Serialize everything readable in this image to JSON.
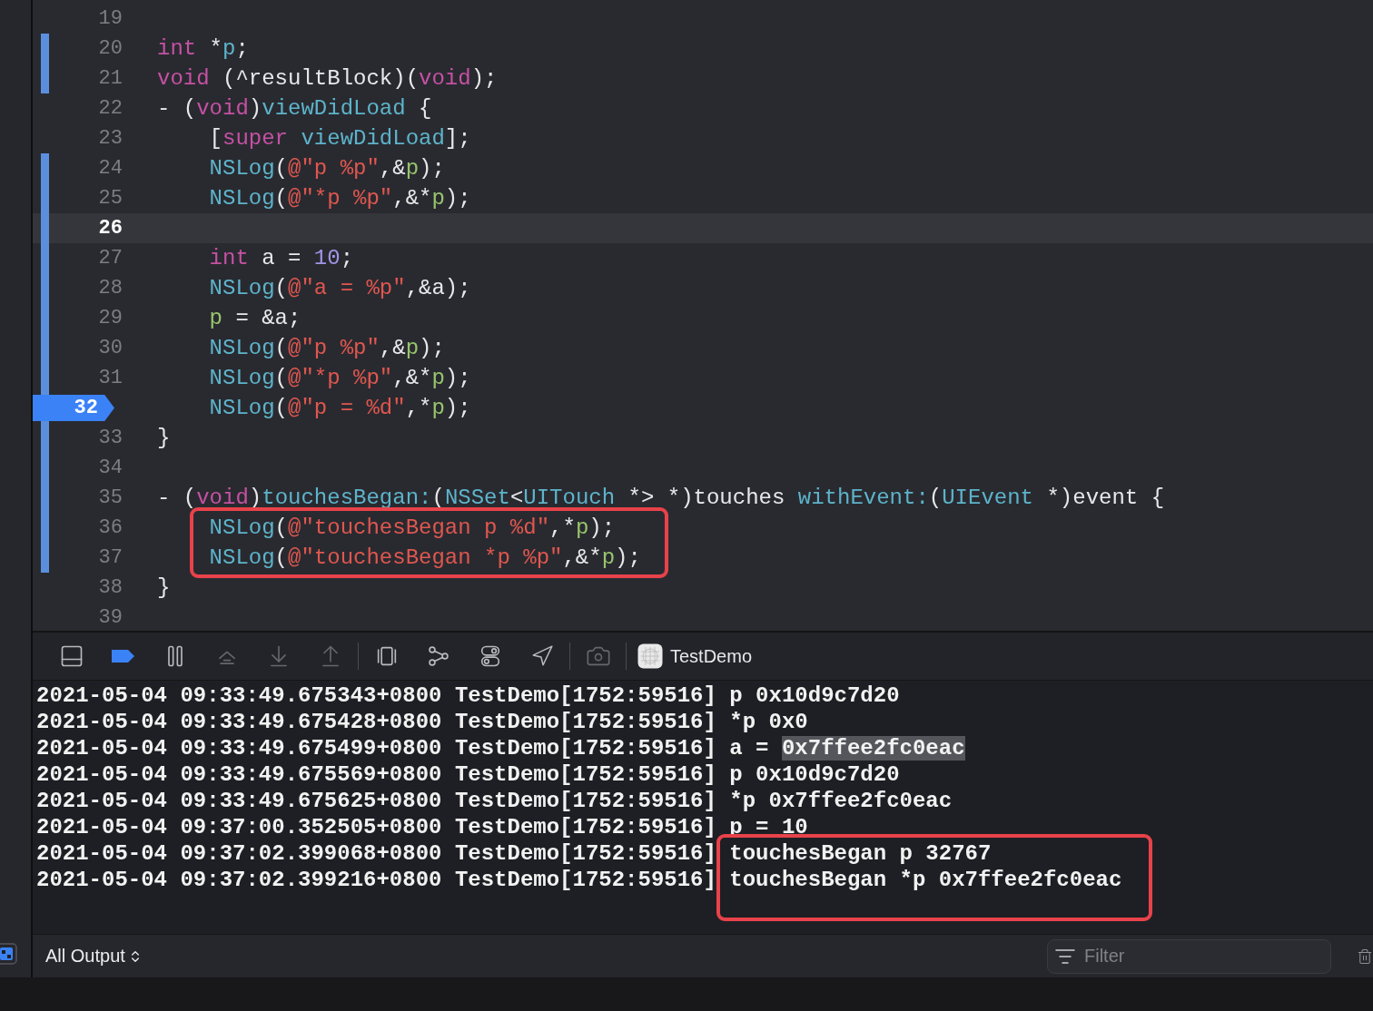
{
  "editor": {
    "lines": [
      {
        "number": "19",
        "changed": false,
        "current": false,
        "breakpoint": false,
        "boxed": false
      },
      {
        "number": "20",
        "changed": true,
        "current": false,
        "breakpoint": false,
        "boxed": false,
        "indented": false,
        "tokens": [
          {
            "text": "int",
            "kind": "keyword"
          },
          {
            "text": " *",
            "kind": "plain"
          },
          {
            "text": "p",
            "kind": "func"
          },
          {
            "text": ";",
            "kind": "plain"
          }
        ]
      },
      {
        "number": "21",
        "changed": true,
        "current": false,
        "breakpoint": false,
        "boxed": false,
        "indented": false,
        "tokens": [
          {
            "text": "void",
            "kind": "keyword"
          },
          {
            "text": " (^resultBlock)(",
            "kind": "plain"
          },
          {
            "text": "void",
            "kind": "keyword"
          },
          {
            "text": ");",
            "kind": "plain"
          }
        ]
      },
      {
        "number": "22",
        "changed": false,
        "current": false,
        "breakpoint": false,
        "boxed": false,
        "indented": false,
        "tokens": [
          {
            "text": "- (",
            "kind": "plain"
          },
          {
            "text": "void",
            "kind": "keyword"
          },
          {
            "text": ")",
            "kind": "plain"
          },
          {
            "text": "viewDidLoad",
            "kind": "func"
          },
          {
            "text": " {",
            "kind": "plain"
          }
        ]
      },
      {
        "number": "23",
        "changed": false,
        "current": false,
        "breakpoint": false,
        "boxed": false,
        "indented": true,
        "tokens": [
          {
            "text": "[",
            "kind": "plain"
          },
          {
            "text": "super",
            "kind": "keyword"
          },
          {
            "text": " viewDidLoad",
            "kind": "func"
          },
          {
            "text": "];",
            "kind": "plain"
          }
        ]
      },
      {
        "number": "24",
        "changed": true,
        "current": false,
        "breakpoint": false,
        "boxed": false,
        "indented": true,
        "tokens": [
          {
            "text": "NSLog",
            "kind": "func"
          },
          {
            "text": "(",
            "kind": "plain"
          },
          {
            "text": "@\"p %p\"",
            "kind": "string"
          },
          {
            "text": ",&",
            "kind": "plain"
          },
          {
            "text": "p",
            "kind": "var"
          },
          {
            "text": ");",
            "kind": "plain"
          }
        ]
      },
      {
        "number": "25",
        "changed": true,
        "current": false,
        "breakpoint": false,
        "boxed": false,
        "indented": true,
        "tokens": [
          {
            "text": "NSLog",
            "kind": "func"
          },
          {
            "text": "(",
            "kind": "plain"
          },
          {
            "text": "@\"*p %p\"",
            "kind": "string"
          },
          {
            "text": ",&*",
            "kind": "plain"
          },
          {
            "text": "p",
            "kind": "var"
          },
          {
            "text": ");",
            "kind": "plain"
          }
        ]
      },
      {
        "number": "26",
        "changed": true,
        "current": true,
        "breakpoint": false,
        "boxed": false
      },
      {
        "number": "27",
        "changed": true,
        "current": false,
        "breakpoint": false,
        "boxed": false,
        "indented": true,
        "tokens": [
          {
            "text": "int",
            "kind": "keyword"
          },
          {
            "text": " a = ",
            "kind": "plain"
          },
          {
            "text": "10",
            "kind": "number"
          },
          {
            "text": ";",
            "kind": "plain"
          }
        ]
      },
      {
        "number": "28",
        "changed": true,
        "current": false,
        "breakpoint": false,
        "boxed": false,
        "indented": true,
        "tokens": [
          {
            "text": "NSLog",
            "kind": "func"
          },
          {
            "text": "(",
            "kind": "plain"
          },
          {
            "text": "@\"a = %p\"",
            "kind": "string"
          },
          {
            "text": ",&a);",
            "kind": "plain"
          }
        ]
      },
      {
        "number": "29",
        "changed": true,
        "current": false,
        "breakpoint": false,
        "boxed": false,
        "indented": true,
        "tokens": [
          {
            "text": "p",
            "kind": "var"
          },
          {
            "text": " = &a;",
            "kind": "plain"
          }
        ]
      },
      {
        "number": "30",
        "changed": true,
        "current": false,
        "breakpoint": false,
        "boxed": false,
        "indented": true,
        "tokens": [
          {
            "text": "NSLog",
            "kind": "func"
          },
          {
            "text": "(",
            "kind": "plain"
          },
          {
            "text": "@\"p %p\"",
            "kind": "string"
          },
          {
            "text": ",&",
            "kind": "plain"
          },
          {
            "text": "p",
            "kind": "var"
          },
          {
            "text": ");",
            "kind": "plain"
          }
        ]
      },
      {
        "number": "31",
        "changed": true,
        "current": false,
        "breakpoint": false,
        "boxed": false,
        "indented": true,
        "tokens": [
          {
            "text": "NSLog",
            "kind": "func"
          },
          {
            "text": "(",
            "kind": "plain"
          },
          {
            "text": "@\"*p %p\"",
            "kind": "string"
          },
          {
            "text": ",&*",
            "kind": "plain"
          },
          {
            "text": "p",
            "kind": "var"
          },
          {
            "text": ");",
            "kind": "plain"
          }
        ]
      },
      {
        "number": "32",
        "changed": true,
        "current": false,
        "breakpoint": true,
        "boxed": false,
        "indented": true,
        "tokens": [
          {
            "text": "NSLog",
            "kind": "func"
          },
          {
            "text": "(",
            "kind": "plain"
          },
          {
            "text": "@\"p = %d\"",
            "kind": "string"
          },
          {
            "text": ",*",
            "kind": "plain"
          },
          {
            "text": "p",
            "kind": "var"
          },
          {
            "text": ");",
            "kind": "plain"
          }
        ]
      },
      {
        "number": "33",
        "changed": true,
        "current": false,
        "breakpoint": false,
        "boxed": false,
        "indented": false,
        "tokens": [
          {
            "text": "}",
            "kind": "plain"
          }
        ]
      },
      {
        "number": "34",
        "changed": true,
        "current": false,
        "breakpoint": false,
        "boxed": false
      },
      {
        "number": "35",
        "changed": true,
        "current": false,
        "breakpoint": false,
        "boxed": false,
        "indented": false,
        "tokens": [
          {
            "text": "- (",
            "kind": "plain"
          },
          {
            "text": "void",
            "kind": "keyword"
          },
          {
            "text": ")",
            "kind": "plain"
          },
          {
            "text": "touchesBegan:",
            "kind": "func"
          },
          {
            "text": "(",
            "kind": "plain"
          },
          {
            "text": "NSSet",
            "kind": "func"
          },
          {
            "text": "<",
            "kind": "plain"
          },
          {
            "text": "UITouch",
            "kind": "func"
          },
          {
            "text": " *> *)touches ",
            "kind": "plain"
          },
          {
            "text": "withEvent:",
            "kind": "func"
          },
          {
            "text": "(",
            "kind": "plain"
          },
          {
            "text": "UIEvent",
            "kind": "func"
          },
          {
            "text": " *)event {",
            "kind": "plain"
          }
        ]
      },
      {
        "number": "36",
        "changed": true,
        "current": false,
        "breakpoint": false,
        "boxed": true,
        "indented": true,
        "tokens": [
          {
            "text": "NSLog",
            "kind": "func"
          },
          {
            "text": "(",
            "kind": "plain"
          },
          {
            "text": "@\"touchesBegan p %d\"",
            "kind": "string"
          },
          {
            "text": ",*",
            "kind": "plain"
          },
          {
            "text": "p",
            "kind": "var"
          },
          {
            "text": ");",
            "kind": "plain"
          }
        ]
      },
      {
        "number": "37",
        "changed": true,
        "current": false,
        "breakpoint": false,
        "boxed": true,
        "indented": true,
        "tokens": [
          {
            "text": "NSLog",
            "kind": "func"
          },
          {
            "text": "(",
            "kind": "plain"
          },
          {
            "text": "@\"touchesBegan *p %p\"",
            "kind": "string"
          },
          {
            "text": ",&*",
            "kind": "plain"
          },
          {
            "text": "p",
            "kind": "var"
          },
          {
            "text": ");",
            "kind": "plain"
          }
        ]
      },
      {
        "number": "38",
        "changed": false,
        "current": false,
        "breakpoint": false,
        "boxed": false,
        "indented": false,
        "tokens": [
          {
            "text": "}",
            "kind": "plain"
          }
        ]
      },
      {
        "number": "39",
        "changed": false,
        "current": false,
        "breakpoint": false,
        "boxed": false
      }
    ]
  },
  "debug_bar": {
    "buttons": [
      {
        "kind": "console-toggle",
        "active": false,
        "disabled": false
      },
      {
        "kind": "breakpoints",
        "active": true,
        "disabled": false
      },
      {
        "kind": "pause",
        "active": false,
        "disabled": false
      },
      {
        "kind": "step-over",
        "active": false,
        "disabled": true
      },
      {
        "kind": "step-into",
        "active": false,
        "disabled": true
      },
      {
        "kind": "step-out",
        "active": false,
        "disabled": true
      },
      {
        "kind": "view-debugger",
        "active": false,
        "disabled": false
      },
      {
        "kind": "memory-graph",
        "active": false,
        "disabled": false
      },
      {
        "kind": "environment",
        "active": false,
        "disabled": false
      },
      {
        "kind": "location",
        "active": false,
        "disabled": false
      },
      {
        "kind": "camera",
        "active": false,
        "disabled": true
      }
    ],
    "process": "TestDemo"
  },
  "console": {
    "lines": [
      {
        "timestamp": "2021-05-04 09:33:49.675343+0800",
        "process": "TestDemo[1752:59516]",
        "message": "p 0x10d9c7d20",
        "boxed": false
      },
      {
        "timestamp": "2021-05-04 09:33:49.675428+0800",
        "process": "TestDemo[1752:59516]",
        "message": "*p 0x0",
        "boxed": false
      },
      {
        "timestamp": "2021-05-04 09:33:49.675499+0800",
        "process": "TestDemo[1752:59516]",
        "message": "a =",
        "selection": "0x7ffee2fc0eac",
        "boxed": false
      },
      {
        "timestamp": "2021-05-04 09:33:49.675569+0800",
        "process": "TestDemo[1752:59516]",
        "message": "p 0x10d9c7d20",
        "boxed": false
      },
      {
        "timestamp": "2021-05-04 09:33:49.675625+0800",
        "process": "TestDemo[1752:59516]",
        "message": "*p 0x7ffee2fc0eac",
        "boxed": false
      },
      {
        "timestamp": "2021-05-04 09:37:00.352505+0800",
        "process": "TestDemo[1752:59516]",
        "message": "p = 10",
        "boxed": false
      },
      {
        "timestamp": "2021-05-04 09:37:02.399068+0800",
        "process": "TestDemo[1752:59516]",
        "message": "touchesBegan p 32767",
        "boxed": true
      },
      {
        "timestamp": "2021-05-04 09:37:02.399216+0800",
        "process": "TestDemo[1752:59516]",
        "message": "touchesBegan *p 0x7ffee2fc0eac",
        "boxed": true
      }
    ]
  },
  "console_footer": {
    "output_menu": "All Output",
    "filter": {
      "placeholder": "Filter"
    }
  }
}
